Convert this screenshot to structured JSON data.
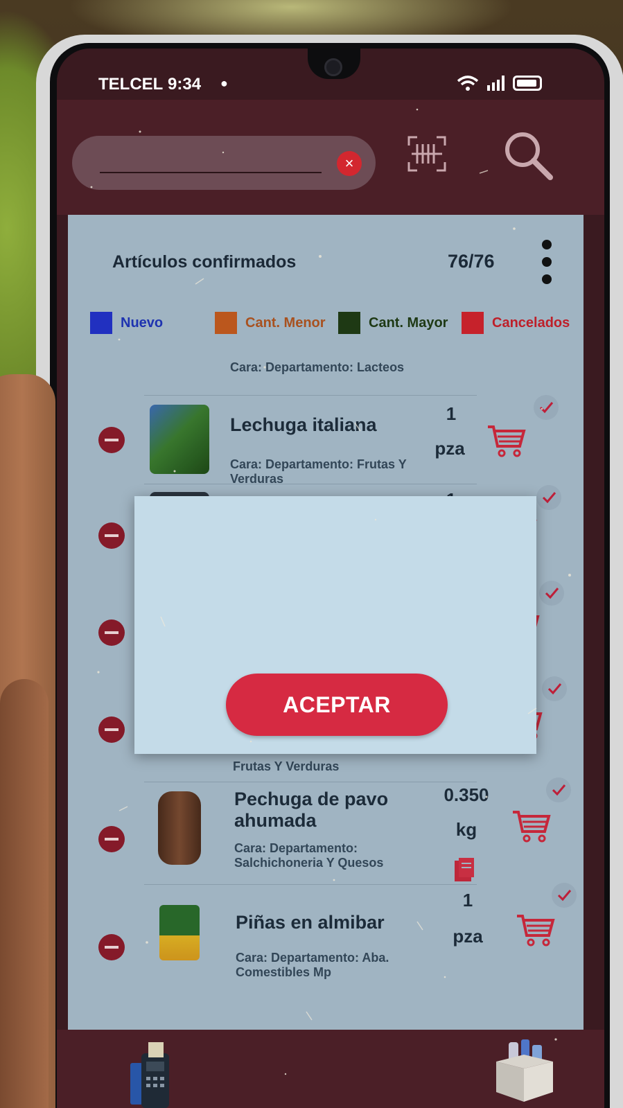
{
  "status_bar": {
    "carrier": "TELCEL",
    "time": "9:34"
  },
  "header": {
    "search_value": "",
    "clear_icon": "clear-icon",
    "barcode_icon": "barcode-scan-icon",
    "search_icon": "search-icon"
  },
  "summary": {
    "title": "Artículos confirmados",
    "count": "76/76"
  },
  "legend": [
    {
      "label": "Nuevo",
      "color": "#2231c9"
    },
    {
      "label": "Cant. Menor",
      "color": "#c55a1d"
    },
    {
      "label": "Cant. Mayor",
      "color": "#1f3a14"
    },
    {
      "label": "Cancelados",
      "color": "#d0222c"
    }
  ],
  "items": [
    {
      "name": "",
      "face_department": "Cara:  Departamento: Lacteos",
      "qty": "",
      "unit": ""
    },
    {
      "name": "Lechuga italiana",
      "face_department": "Cara:  Departamento: Frutas Y Verduras",
      "qty": "1",
      "unit": "pza"
    },
    {
      "name": "",
      "face_department": "",
      "qty": "1",
      "unit": ""
    },
    {
      "name": "",
      "face_department": "Frutas Y Verduras",
      "qty": "",
      "unit": ""
    },
    {
      "name": "Pechuga de pavo ahumada",
      "face_department": "Cara:  Departamento: Salchichoneria Y Quesos",
      "qty": "0.350",
      "unit": "kg"
    },
    {
      "name": "Piñas en almibar",
      "face_department": "Cara:  Departamento: Aba. Comestibles Mp",
      "qty": "1",
      "unit": "pza"
    }
  ],
  "modal": {
    "accept_label": "ACEPTAR"
  },
  "colors": {
    "brand": "#4b1f27",
    "accent": "#d62a42",
    "card": "#a8bccb"
  }
}
